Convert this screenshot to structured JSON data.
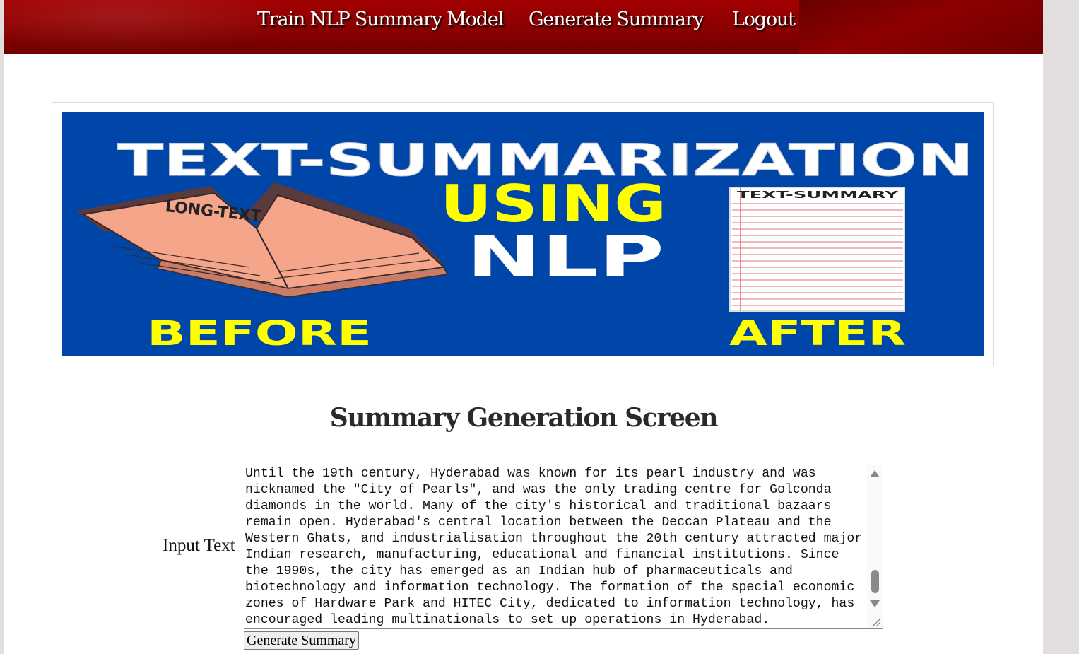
{
  "nav": {
    "items": [
      {
        "label": "Train NLP Summary Model"
      },
      {
        "label": "Generate Summary"
      },
      {
        "label": "Logout"
      }
    ]
  },
  "banner": {
    "title": "TEXT-SUMMARIZATION",
    "using": "USING",
    "nlp": "NLP",
    "book_label": "LONG-TEXT",
    "sheet_label": "TEXT-SUMMARY",
    "before": "BEFORE",
    "after": "AFTER"
  },
  "form": {
    "heading": "Summary Generation Screen",
    "input_label": "Input Text",
    "input_value": "Until the 19th century, Hyderabad was known for its pearl industry and was\nnicknamed the \"City of Pearls\", and was the only trading centre for Golconda\ndiamonds in the world. Many of the city's historical and traditional bazaars\nremain open. Hyderabad's central location between the Deccan Plateau and the\nWestern Ghats, and industrialisation throughout the 20th century attracted major\nIndian research, manufacturing, educational and financial institutions. Since\nthe 1990s, the city has emerged as an Indian hub of pharmaceuticals and\nbiotechnology and information technology. The formation of the special economic\nzones of Hardware Park and HITEC City, dedicated to information technology, has\nencouraged leading multinationals to set up operations in Hyderabad.",
    "submit_label": "Generate Summary"
  },
  "colors": {
    "navbar": "#990000",
    "banner_bg": "#0045a8",
    "banner_yellow": "#ffff00",
    "book": "#f4a58a"
  }
}
